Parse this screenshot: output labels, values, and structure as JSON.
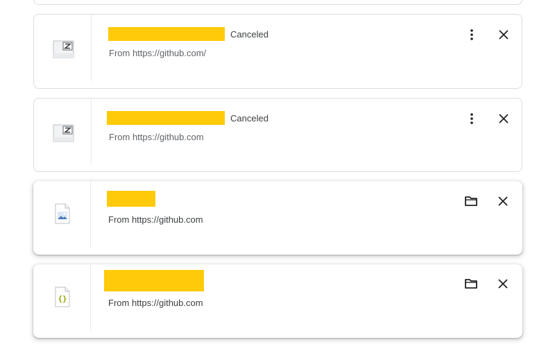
{
  "downloads": [
    {
      "file_type": "zip-file-icon",
      "status": "Canceled",
      "source": "From https://github.com/",
      "actions": [
        "more-options",
        "remove"
      ]
    },
    {
      "file_type": "zip-file-icon",
      "status": "Canceled",
      "source": "From https://github.com",
      "actions": [
        "more-options",
        "remove"
      ]
    },
    {
      "file_type": "image-file-icon",
      "status": "",
      "source": "From https://github.com",
      "actions": [
        "show-in-folder",
        "remove"
      ]
    },
    {
      "file_type": "json-file-icon",
      "status": "",
      "source": "From https://github.com",
      "actions": [
        "show-in-folder",
        "remove"
      ]
    }
  ],
  "colors": {
    "redaction": "#ffca0a",
    "border": "#dadce0",
    "icon": "#202124"
  }
}
